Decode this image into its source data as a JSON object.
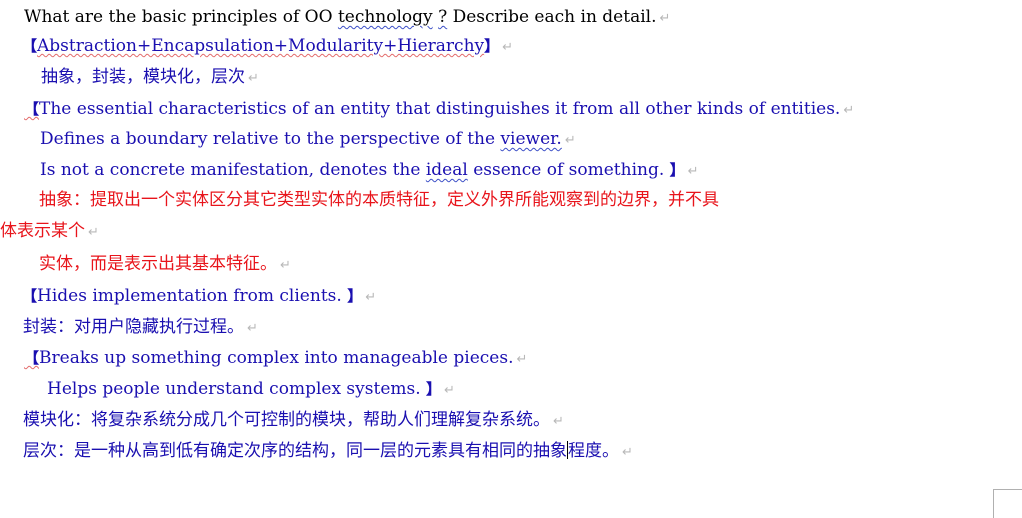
{
  "question": {
    "pre": "What are the basic principles of OO ",
    "u1": "technology",
    "sp": " ",
    "u2": "?",
    "post": " Describe each in detail."
  },
  "heading": {
    "bracket_open": "【",
    "text": "Abstraction+Encapsulation+Modularity+Hierarchy",
    "bracket_close": "】"
  },
  "heading_cn": "抽象，封装，模块化，层次",
  "abstraction": {
    "bracket_open": "【",
    "line1": "The essential characteristics of an entity that distinguishes it    from all other kinds of entities.",
    "line2_pre": "Defines a boundary relative to the perspective of the ",
    "line2_u": "viewer.",
    "line3_pre": "Is not a concrete manifestation, denotes the ",
    "line3_u": "  ideal",
    "line3_post": " essence of something. ",
    "bracket_close": "】",
    "cn_line1": "抽象：提取出一个实体区分其它类型实体的本质特征，定义外界所能观察到的边界，并不具",
    "cn_line2": "体表示某个",
    "cn_line3": "实体，而是表示出其基本特征。"
  },
  "encapsulation": {
    "bracket_open": "【",
    "text": "Hides implementation from clients. ",
    "bracket_close": "】",
    "cn": "封装：对用户隐藏执行过程。"
  },
  "modularity": {
    "bracket_open": "【",
    "line1": "Breaks up something complex into manageable pieces.",
    "line2": "Helps people understand complex systems. ",
    "bracket_close": "】",
    "cn": "模块化：将复杂系统分成几个可控制的模块，帮助人们理解复杂系统。"
  },
  "hierarchy": {
    "cn_pre": "层次：是一种从高到低有确定次序的结构，同一层的元素具有相同的抽象",
    "cn_post": "程度。"
  },
  "paragraph_mark": "↵"
}
